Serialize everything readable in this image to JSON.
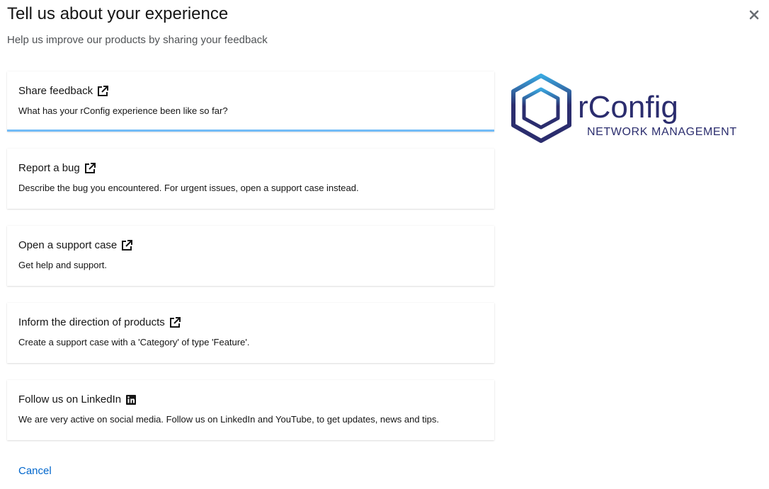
{
  "header": {
    "title": "Tell us about your experience",
    "subtitle": "Help us improve our products by sharing your feedback"
  },
  "cards": [
    {
      "title": "Share feedback",
      "description": "What has your rConfig experience been like so far?",
      "icon": "external-link-icon",
      "selected": true
    },
    {
      "title": "Report a bug",
      "description": "Describe the bug you encountered. For urgent issues, open a support case instead.",
      "icon": "external-link-icon",
      "selected": false
    },
    {
      "title": "Open a support case",
      "description": "Get help and support.",
      "icon": "external-link-icon",
      "selected": false
    },
    {
      "title": "Inform the direction of products",
      "description": "Create a support case with a 'Category' of type 'Feature'.",
      "icon": "external-link-icon",
      "selected": false
    },
    {
      "title": "Follow us on LinkedIn",
      "description": "We are very active on social media. Follow us on LinkedIn and YouTube, to get updates, news and tips.",
      "icon": "linkedin-icon",
      "selected": false
    }
  ],
  "logo": {
    "name": "rConfig",
    "tagline": "NETWORK MANAGEMENT"
  },
  "footer": {
    "cancel_label": "Cancel"
  },
  "colors": {
    "accent": "#73bcf7",
    "link": "#0066cc",
    "logo_dark": "#2b2d6e",
    "logo_light": "#3aa8e0"
  }
}
